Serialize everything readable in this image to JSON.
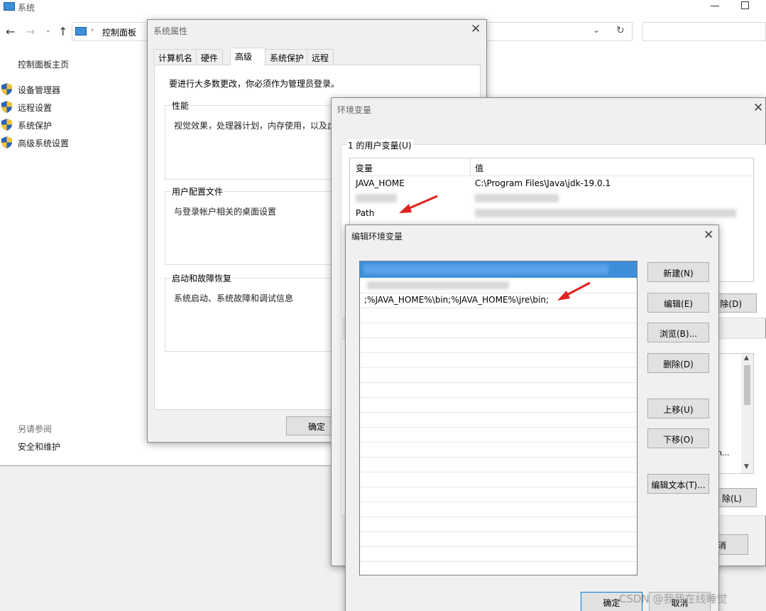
{
  "system_window": {
    "title": "系统",
    "breadcrumb": "控制面板",
    "sidebar": {
      "home": "控制面板主页",
      "items": [
        {
          "label": "设备管理器",
          "icon": "shield-icon"
        },
        {
          "label": "远程设置",
          "icon": "shield-icon"
        },
        {
          "label": "系统保护",
          "icon": "shield-icon"
        },
        {
          "label": "高级系统设置",
          "icon": "shield-icon"
        }
      ],
      "see_also": "另请参阅",
      "security": "安全和维护"
    }
  },
  "sysprops": {
    "title": "系统属性",
    "tabs": [
      "计算机名",
      "硬件",
      "高级",
      "系统保护",
      "远程"
    ],
    "active_tab": "高级",
    "admin_note": "要进行大多数更改，你必须作为管理员登录。",
    "groups": [
      {
        "title": "性能",
        "desc": "视觉效果，处理器计划，内存使用，以及虚"
      },
      {
        "title": "用户配置文件",
        "desc": "与登录帐户相关的桌面设置"
      },
      {
        "title": "启动和故障恢复",
        "desc": "系统启动、系统故障和调试信息"
      }
    ],
    "ok": "确定"
  },
  "envvars": {
    "title": "环境变量",
    "user_vars_label": "1 的用户变量(U)",
    "columns": [
      "变量",
      "值"
    ],
    "rows": [
      {
        "name": "JAVA_HOME",
        "value": "C:\\Program Files\\Java\\jdk-19.0.1"
      },
      {
        "name": "Path",
        "value": "..."
      }
    ],
    "delete_partial": "除(D)",
    "delete_partial2": "除(L)",
    "cancel_partial": "消",
    "list_partial": "n..."
  },
  "editvar": {
    "title": "编辑环境变量",
    "entries": [
      "",
      ";%JAVA_HOME%\\bin;%JAVA_HOME%\\jre\\bin;"
    ],
    "buttons": {
      "new": "新建(N)",
      "edit": "编辑(E)",
      "browse": "浏览(B)...",
      "delete": "删除(D)",
      "up": "上移(U)",
      "down": "下移(O)",
      "edit_text": "编辑文本(T)..."
    },
    "ok": "确定",
    "cancel": "取消"
  },
  "watermark": "CSDN @我我在线睡觉"
}
